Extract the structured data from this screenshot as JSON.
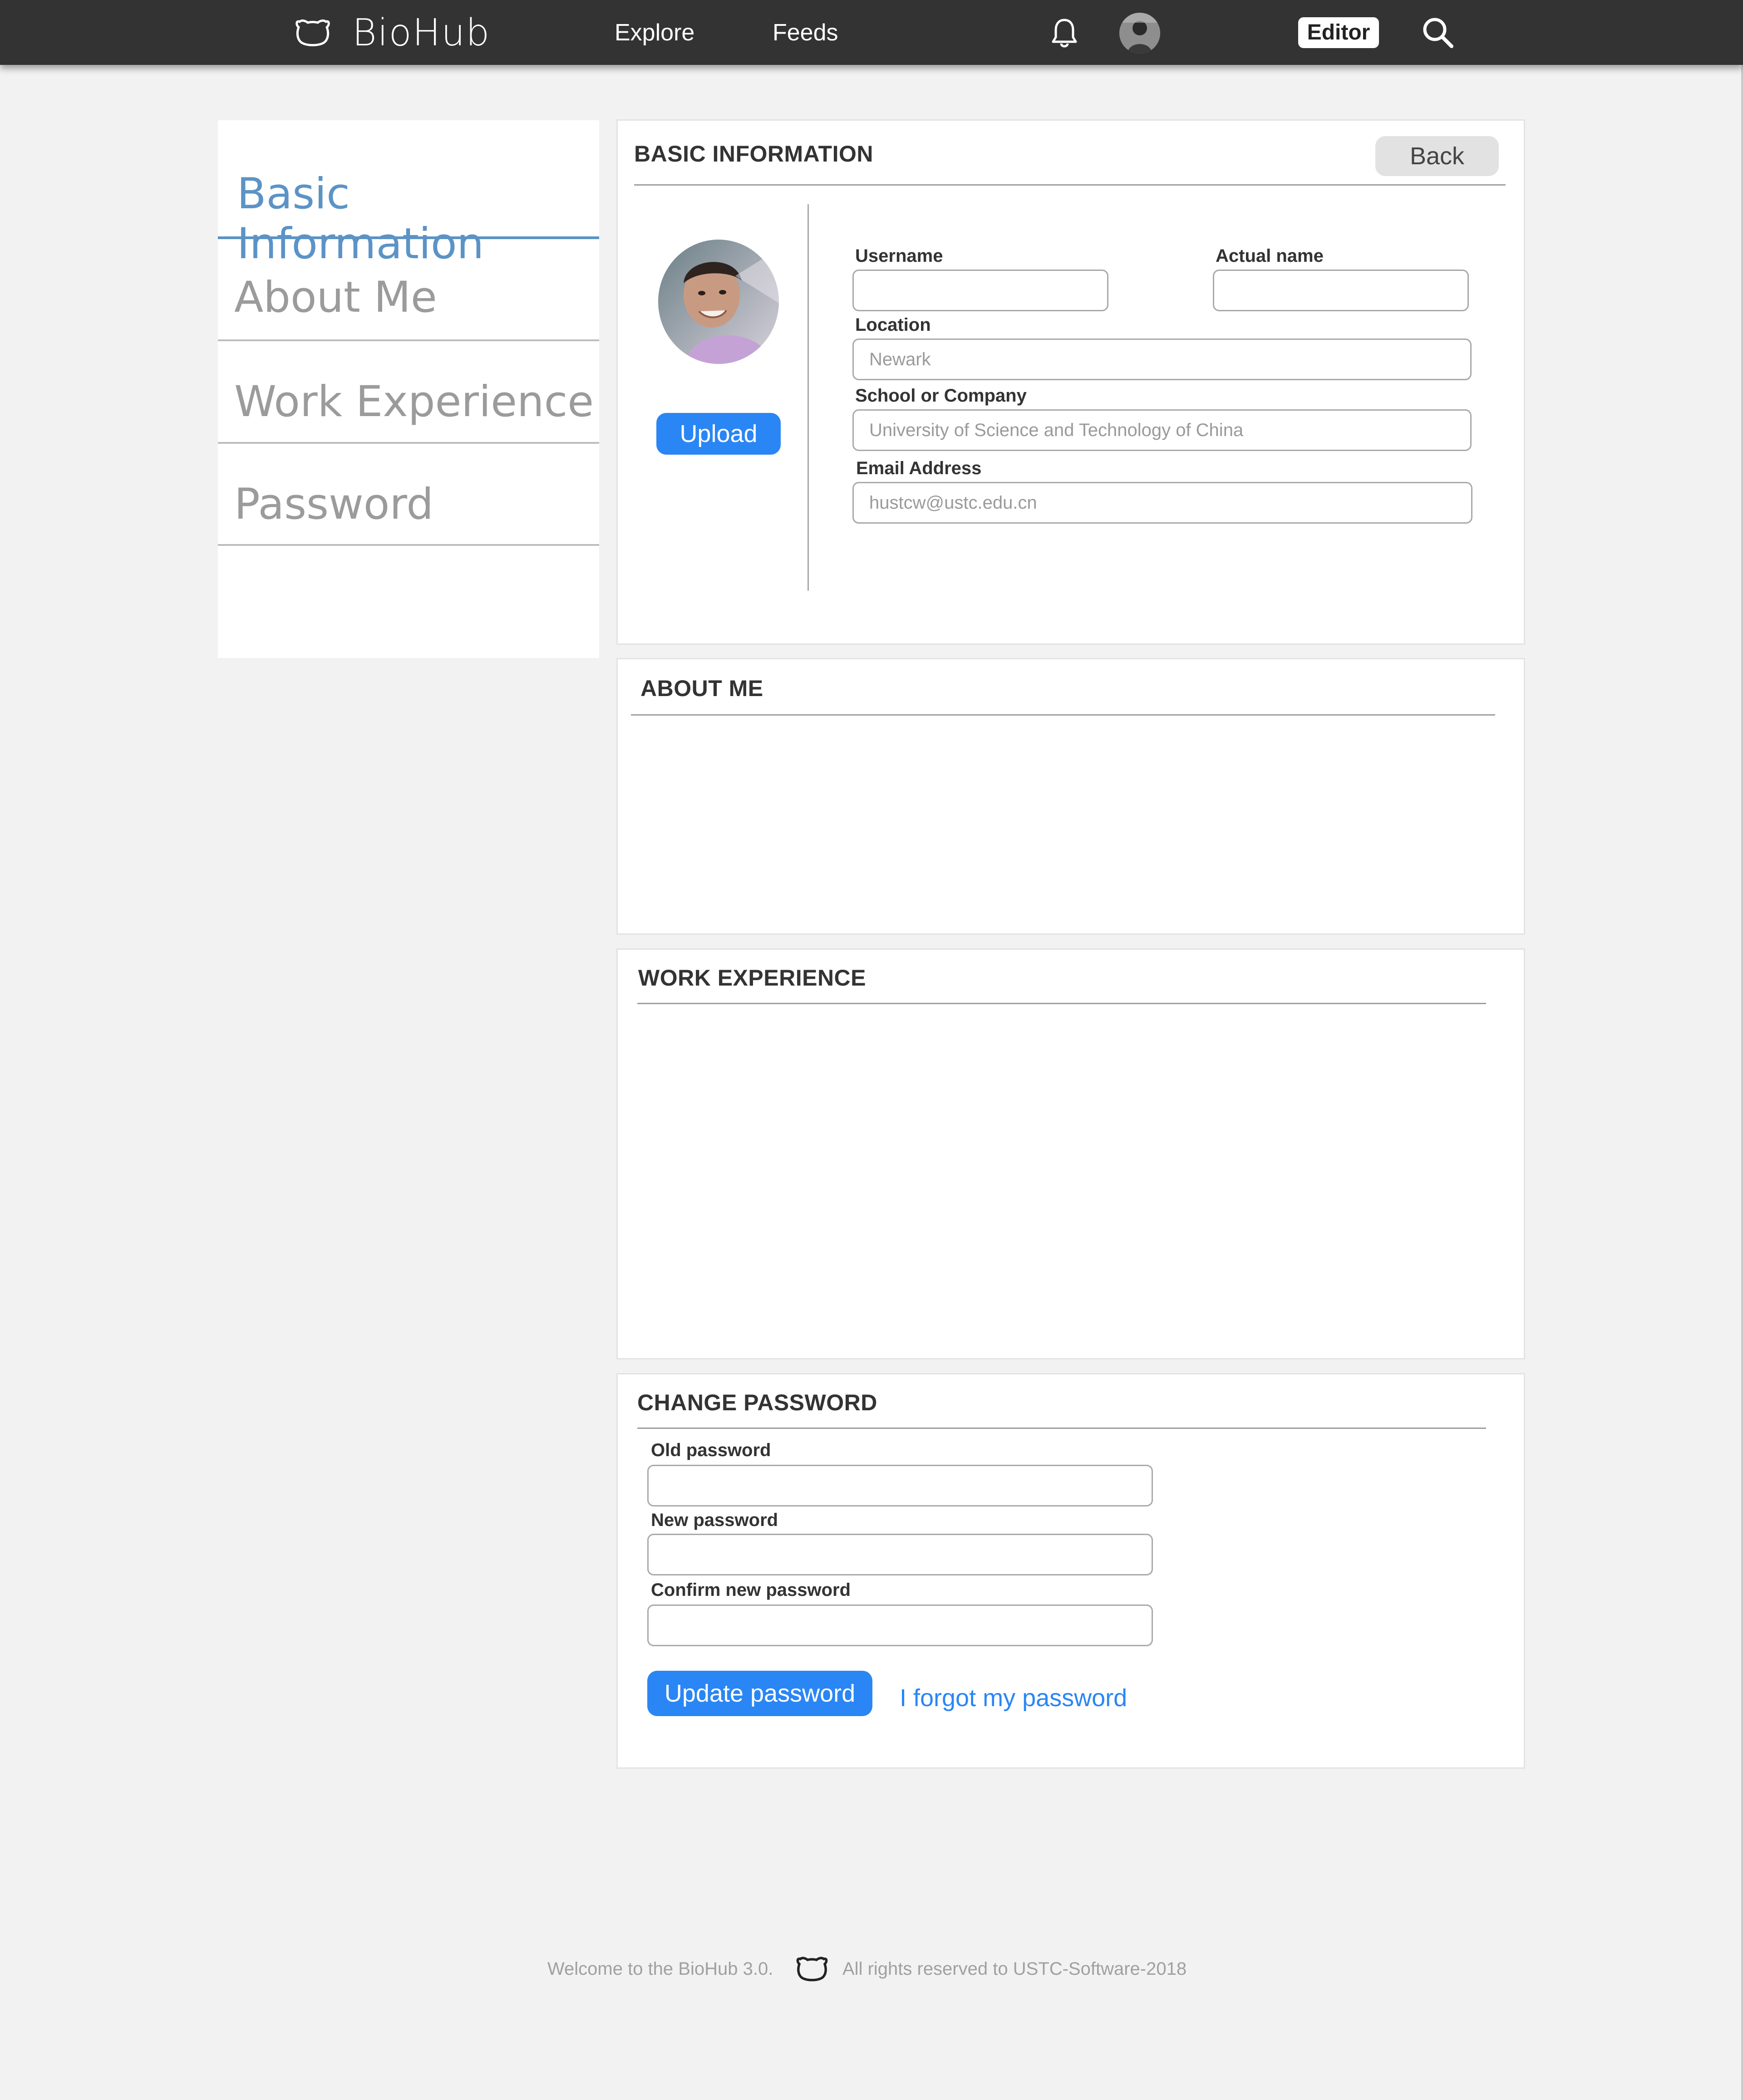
{
  "colors": {
    "topbar": "#333333",
    "accent": "#2a86f4",
    "active_tab": "#5b93c6",
    "page_bg": "#f2f2f2"
  },
  "header": {
    "logo_icon": "bear-face-icon",
    "brand": "BioHub",
    "nav": [
      {
        "label": "Explore"
      },
      {
        "label": "Feeds"
      }
    ],
    "bell_icon": "bell-icon",
    "avatar_icon": "user-avatar",
    "editor_label": "Editor",
    "search_icon": "search-icon"
  },
  "sidebar": {
    "items": [
      {
        "label": "Basic Information",
        "active": true
      },
      {
        "label": "About Me",
        "active": false
      },
      {
        "label": "Work Experience",
        "active": false
      },
      {
        "label": "Password",
        "active": false
      }
    ]
  },
  "basic_info": {
    "title": "BASIC INFORMATION",
    "back_label": "Back",
    "upload_label": "Upload",
    "username": {
      "label": "Username",
      "value": "",
      "placeholder": ""
    },
    "actual_name": {
      "label": "Actual name",
      "value": "",
      "placeholder": ""
    },
    "location": {
      "label": "Location",
      "placeholder": "Newark"
    },
    "school": {
      "label": "School or Company",
      "placeholder": "University of Science and Technology of China"
    },
    "email": {
      "label": "Email Address",
      "placeholder": "hustcw@ustc.edu.cn"
    }
  },
  "about_me": {
    "title": "ABOUT ME"
  },
  "work_experience": {
    "title": "WORK EXPERIENCE"
  },
  "change_password": {
    "title": "CHANGE PASSWORD",
    "old_label": "Old password",
    "new_label": "New password",
    "confirm_label": "Confirm new password",
    "update_label": "Update password",
    "forgot_label": "I forgot my password"
  },
  "footer": {
    "welcome": "Welcome to the BioHub 3.0.",
    "icon": "bear-face-icon",
    "rights": "All rights reserved to USTC-Software-2018"
  }
}
